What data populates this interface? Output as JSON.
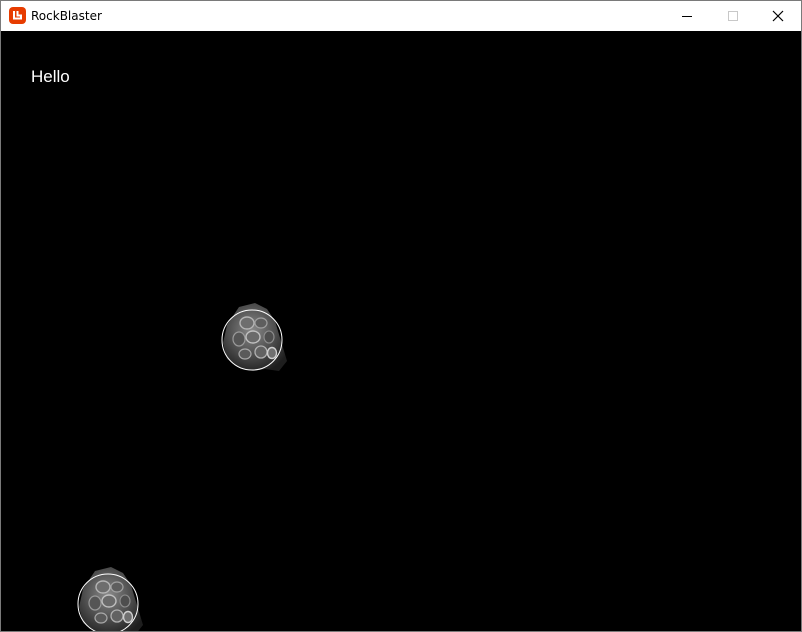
{
  "window": {
    "title": "RockBlaster",
    "icon": "monogame-logo-icon",
    "accent_color": "#e73c00",
    "controls": {
      "minimize": "minimize-icon",
      "maximize": "maximize-icon",
      "close": "close-icon"
    }
  },
  "game": {
    "background_color": "#000000",
    "hud_text": "Hello",
    "hud_color": "#ffffff",
    "rock_count": 2
  }
}
